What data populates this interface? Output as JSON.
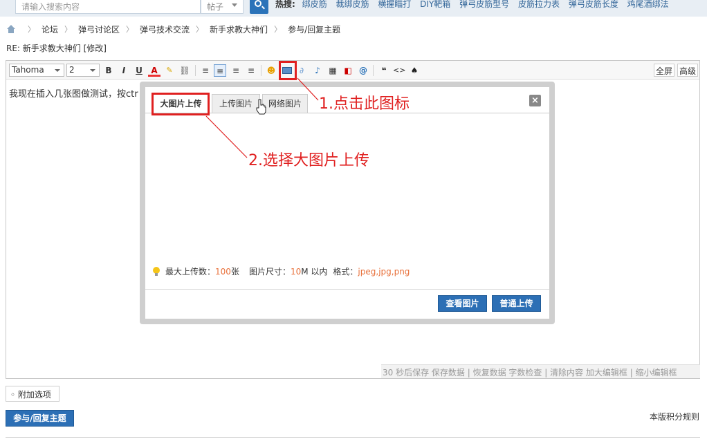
{
  "search": {
    "placeholder": "请输入搜索内容",
    "type": "帖子",
    "hot_label": "热搜:",
    "hot_links": [
      "绑皮筋",
      "裁绑皮筋",
      "横握瞄打",
      "DIY靶箱",
      "弹弓皮筋型号",
      "皮筋拉力表",
      "弹弓皮筋长度",
      "鸡尾酒绑法"
    ]
  },
  "breadcrumb": [
    "论坛",
    "弹弓讨论区",
    "弹弓技术交流",
    "新手求教大神们",
    "参与/回复主题"
  ],
  "post_title": "RE: 新手求教大神们 [修改]",
  "toolbar": {
    "font": "Tahoma",
    "size": "2",
    "fullscreen": "全屏",
    "advanced": "高级",
    "bold": "B",
    "italic": "I",
    "underline": "U",
    "font_color": "A",
    "quote": "❝",
    "code": "<>",
    "at": "@"
  },
  "editor": {
    "body_text": "我现在插入几张图做测试，按ctr",
    "status": "30 秒后保存 保存数据 | 恢复数据    字数检查 | 清除内容    加大编辑框 | 缩小编辑框"
  },
  "dialog": {
    "tabs": [
      "大图片上传",
      "上传图片",
      "网络图片"
    ],
    "close": "×",
    "info": {
      "max_label": "最大上传数：",
      "max_value": "100",
      "max_unit": " 张",
      "size_label": "图片尺寸：",
      "size_value": "10",
      "size_unit": " M 以内",
      "format_label": "格式：",
      "format_value": "jpeg,jpg,png"
    },
    "view_button": "查看图片",
    "normal_upload_button": "普通上传"
  },
  "annotations": {
    "step1": "1.点击此图标",
    "step2": "2.选择大图片上传"
  },
  "footer": {
    "more_options": "◦ 附加选项",
    "submit": "参与/回复主题",
    "rules": "本版积分规则"
  },
  "colors": {
    "accent": "#2c6fb5",
    "annotation_red": "#e02020",
    "highlight_orange": "#e8703a"
  }
}
